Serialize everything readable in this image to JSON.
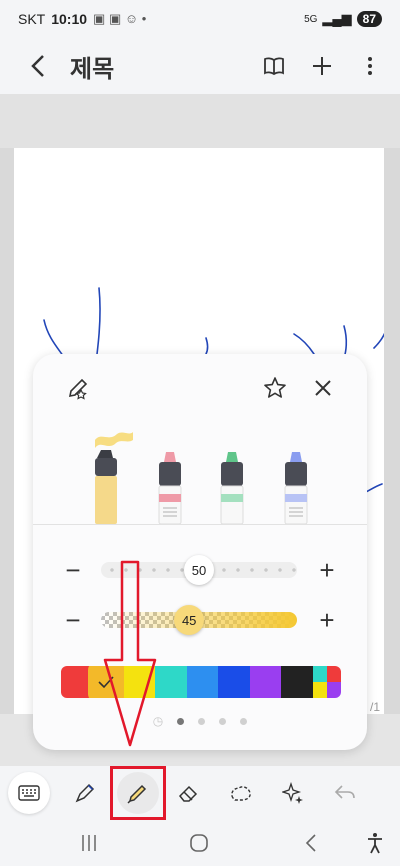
{
  "status": {
    "carrier": "SKT",
    "time": "10:10",
    "network": "5G",
    "battery": "87"
  },
  "header": {
    "title": "제목"
  },
  "panel": {
    "slider_size": {
      "value": "50",
      "level": 0.5
    },
    "slider_opacity": {
      "value": "45",
      "level": 0.45
    },
    "palette": [
      "#ef3b3b",
      "#f5b92b",
      "#f4e20f",
      "#2ed8c8",
      "#2d8ff0",
      "#1a4de8",
      "#9a3ef0",
      "#222222"
    ],
    "selected_color": "#f5b92b",
    "page_dots": 4,
    "active_dot": 0
  },
  "page_indicator": "/1",
  "toolbar": {
    "tools": [
      "keyboard-icon",
      "pen-icon",
      "highlighter-icon",
      "eraser-icon",
      "lasso-icon",
      "sparkle-icon",
      "undo-icon"
    ],
    "active_tool": "highlighter-icon"
  },
  "colors": {
    "accent": "#f3b929",
    "annotation": "#e2182b"
  }
}
